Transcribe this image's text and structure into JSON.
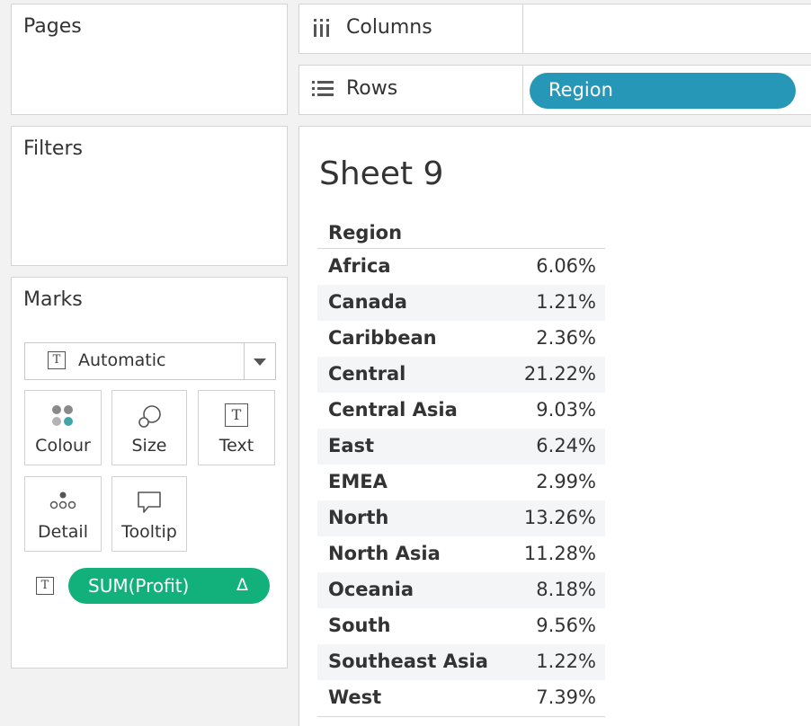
{
  "pages": {
    "title": "Pages"
  },
  "filters": {
    "title": "Filters"
  },
  "marks": {
    "title": "Marks",
    "mark_type": "Automatic",
    "buttons": {
      "colour": "Colour",
      "size": "Size",
      "text": "Text",
      "detail": "Detail",
      "tooltip": "Tooltip"
    },
    "text_field": "SUM(Profit)",
    "text_field_badge": "Δ",
    "text_icon_glyph": "T"
  },
  "shelves": {
    "columns": {
      "label": "Columns",
      "icon": "columns-icon"
    },
    "rows": {
      "label": "Rows",
      "icon": "rows-icon",
      "pill": "Region"
    }
  },
  "sheet": {
    "title": "Sheet 9",
    "column_header": "Region",
    "rows": [
      {
        "region": "Africa",
        "value": "6.06%"
      },
      {
        "region": "Canada",
        "value": "1.21%"
      },
      {
        "region": "Caribbean",
        "value": "2.36%"
      },
      {
        "region": "Central",
        "value": "21.22%"
      },
      {
        "region": "Central Asia",
        "value": "9.03%"
      },
      {
        "region": "East",
        "value": "6.24%"
      },
      {
        "region": "EMEA",
        "value": "2.99%"
      },
      {
        "region": "North",
        "value": "13.26%"
      },
      {
        "region": "North Asia",
        "value": "11.28%"
      },
      {
        "region": "Oceania",
        "value": "8.18%"
      },
      {
        "region": "South",
        "value": "9.56%"
      },
      {
        "region": "Southeast Asia",
        "value": "1.22%"
      },
      {
        "region": "West",
        "value": "7.39%"
      }
    ]
  },
  "colors": {
    "dimension_pill": "#2697b7",
    "measure_pill": "#12b07a"
  }
}
